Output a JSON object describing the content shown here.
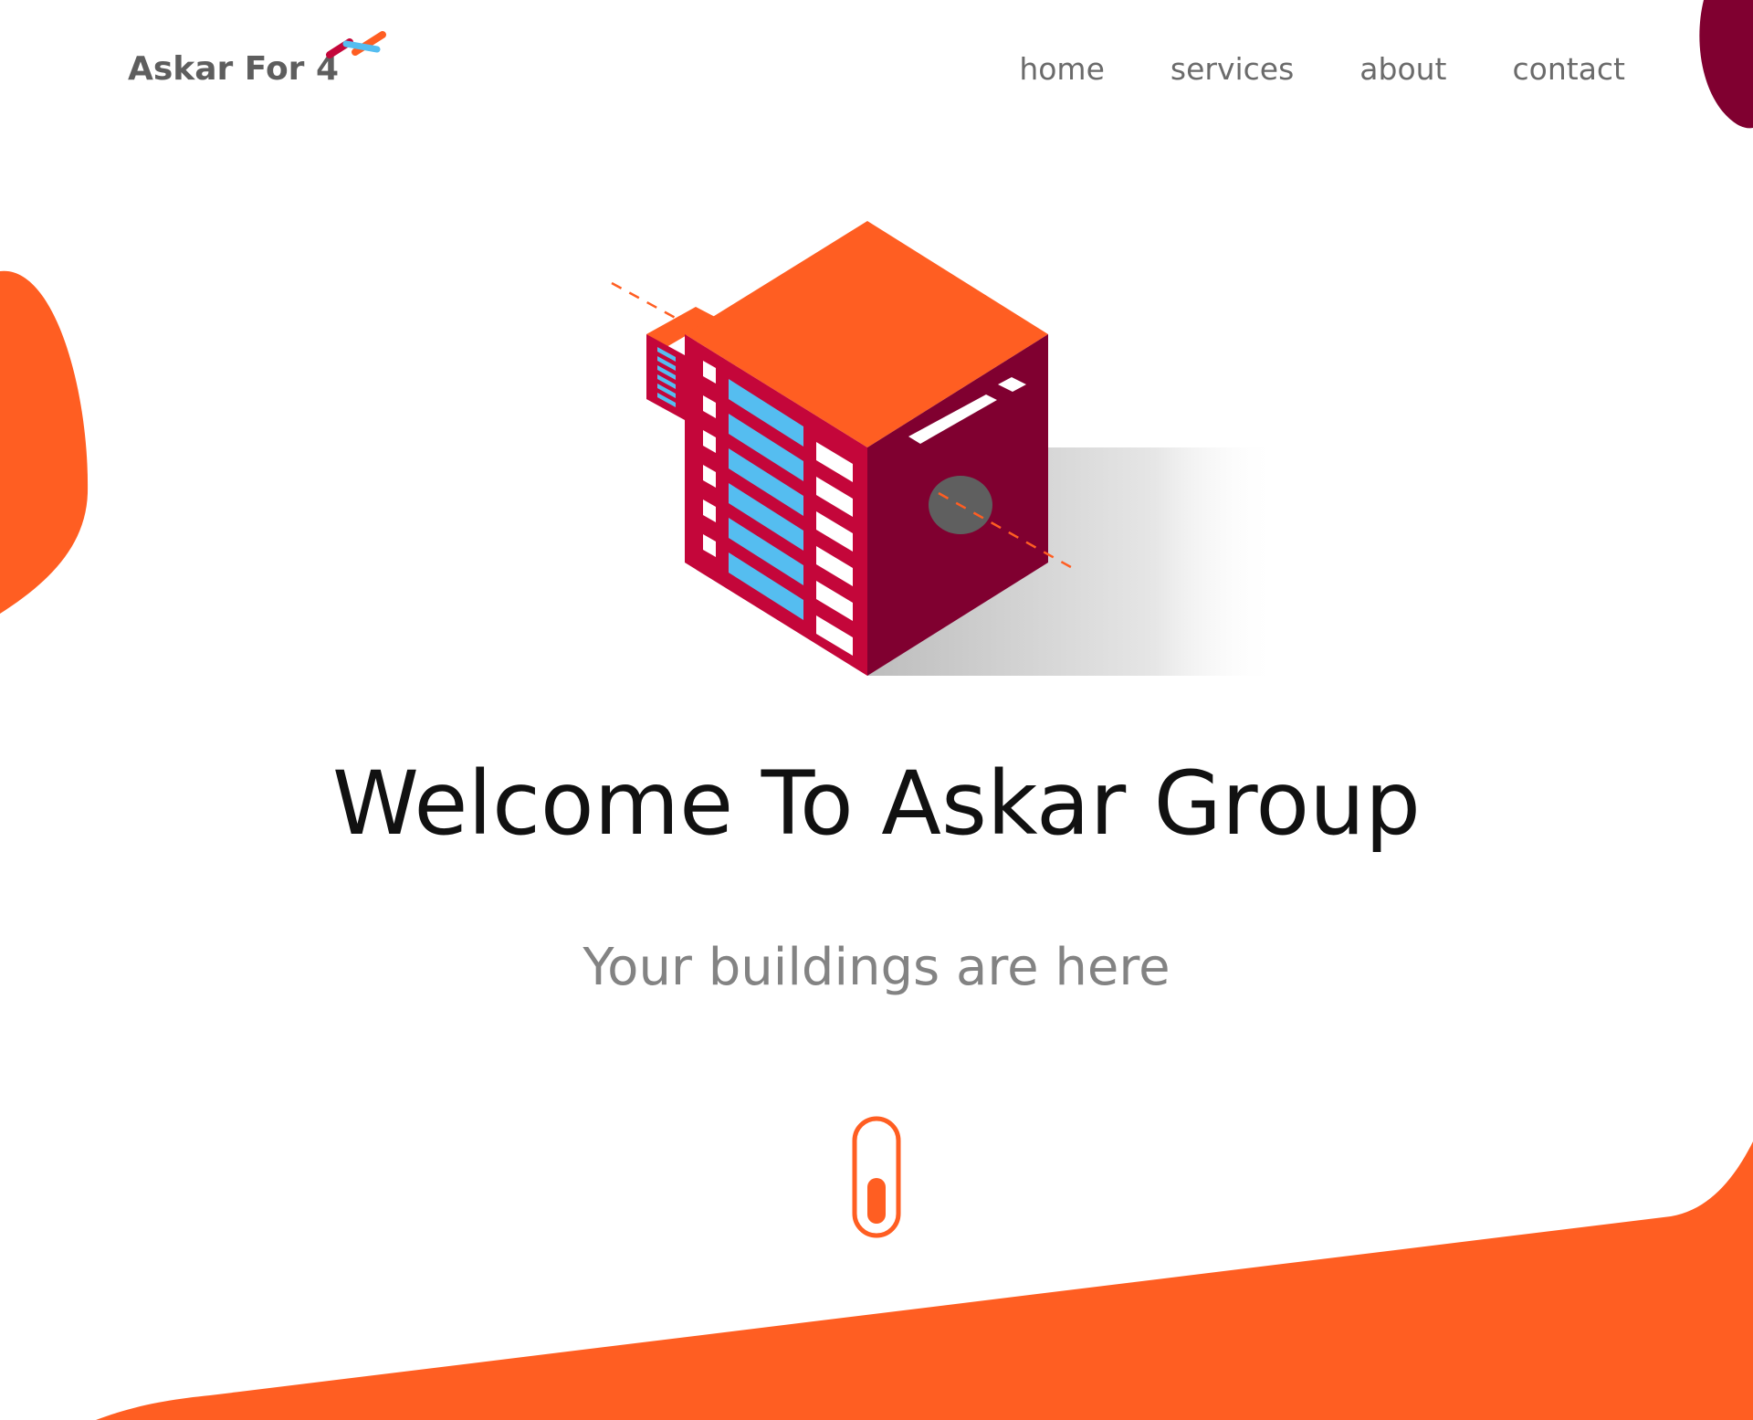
{
  "header": {
    "brand_text": "Askar For 4",
    "nav": [
      {
        "label": "home"
      },
      {
        "label": "services"
      },
      {
        "label": "about"
      },
      {
        "label": "contact"
      }
    ]
  },
  "hero": {
    "title": "Welcome To Askar Group",
    "subtitle": "Your buildings are here"
  },
  "icons": {
    "brand_mark": "brand-logo-icon",
    "building": "isometric-building-illustration",
    "scroll": "scroll-mouse-icon"
  },
  "colors": {
    "accent_orange": "#FF5E22",
    "maroon": "#800030",
    "crimson": "#C4063A",
    "window_blue": "#55BDF0",
    "text_dark": "#111111",
    "text_grey": "#838383",
    "nav_grey": "#6B6B6B"
  }
}
